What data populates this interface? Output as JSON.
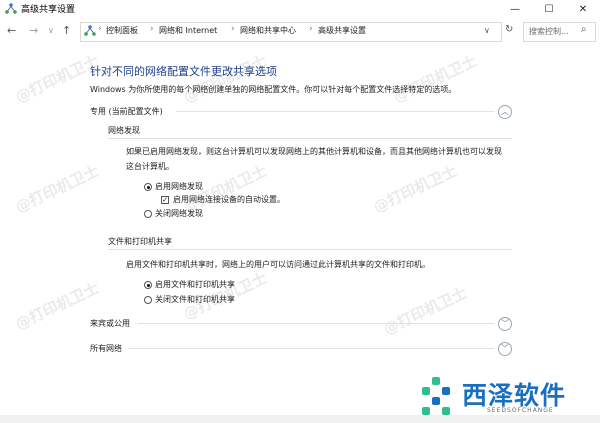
{
  "window": {
    "title": "高级共享设置",
    "minimize": "—",
    "maximize": "☐",
    "close": "✕"
  },
  "nav": {
    "back": "←",
    "forward": "→",
    "recent": "∨",
    "up": "↑",
    "breadcrumbs": [
      "控制面板",
      "网络和 Internet",
      "网络和共享中心",
      "高级共享设置"
    ],
    "dropdown": "∨",
    "refresh": "↻",
    "search_placeholder": "搜索控制...",
    "search_icon": "⌕"
  },
  "main": {
    "heading": "针对不同的网络配置文件更改共享选项",
    "description": "Windows 为你所使用的每个网络创建单独的网络配置文件。你可以针对每个配置文件选择特定的选项。",
    "private_profile": {
      "label": "专用 (当前配置文件)",
      "chevron": "︿",
      "network_discovery": {
        "title": "网络发现",
        "text": "如果已启用网络发现，则这台计算机可以发现网络上的其他计算机和设备，而且其他网络计算机也可以发现这台计算机。",
        "option_on": "启用网络发现",
        "option_auto": "启用网络连接设备的自动设置。",
        "option_off": "关闭网络发现",
        "selected": "on",
        "auto_checked": true
      },
      "file_sharing": {
        "title": "文件和打印机共享",
        "text": "启用文件和打印机共享时，网络上的用户可以访问通过此计算机共享的文件和打印机。",
        "option_on": "启用文件和打印机共享",
        "option_off": "关闭文件和打印机共享",
        "selected": "on"
      }
    },
    "guest_profile": {
      "label": "来宾或公用",
      "chevron": "﹀"
    },
    "all_networks": {
      "label": "所有网络",
      "chevron": "﹀"
    }
  },
  "watermark": "@打印机卫士",
  "logo": {
    "name": "西泽软件",
    "sub": "SEEDSOFCHANGE"
  }
}
